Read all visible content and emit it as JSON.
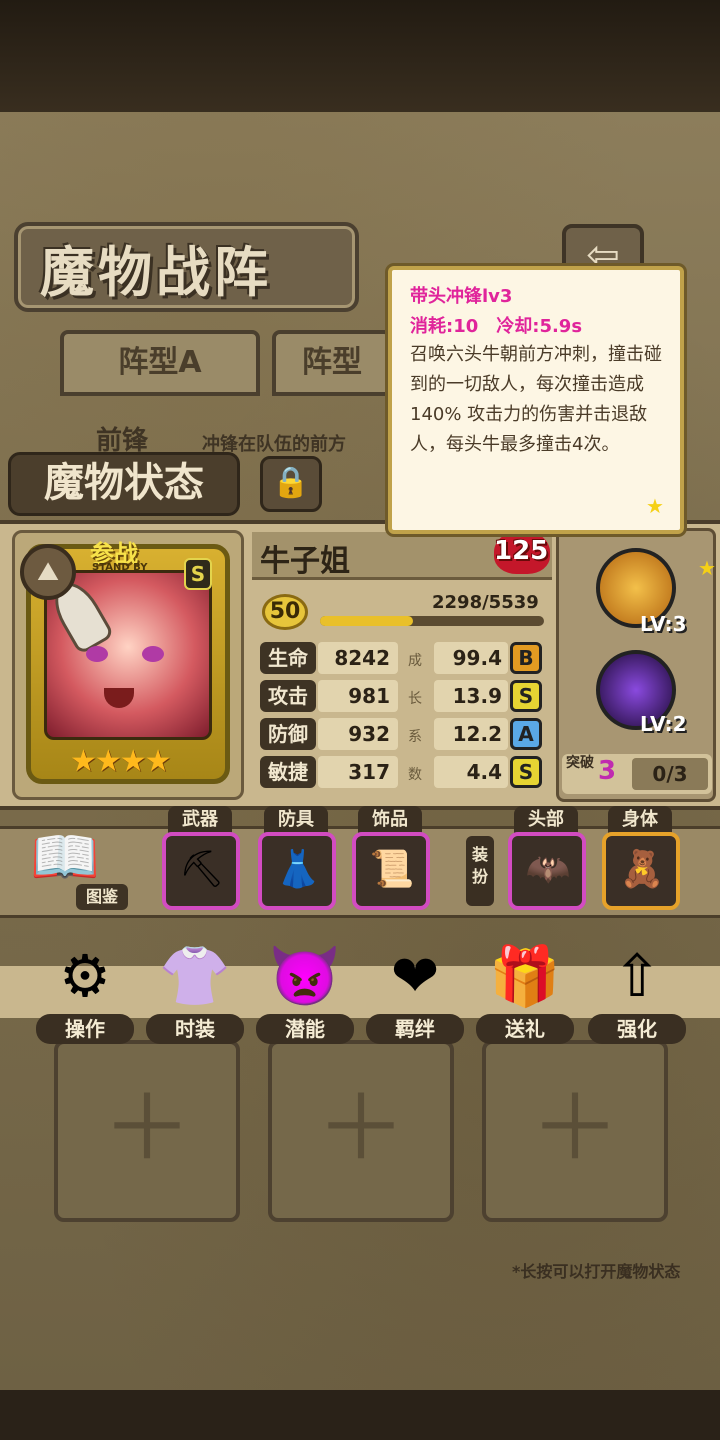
{
  "header": {
    "title": "魔物战阵",
    "back_icon": "⇦"
  },
  "tabs": [
    {
      "label": "阵型A"
    },
    {
      "label": "阵型"
    }
  ],
  "frontline": {
    "label": "前锋",
    "desc": "冲锋在队伍的前方"
  },
  "status": {
    "label": "魔物状态",
    "lock_icon": "🔒"
  },
  "monster": {
    "name": "牛子姐",
    "power": "125",
    "standby": "参战",
    "standby_sub": "STAND BY",
    "rank": "S",
    "stars": "★★★★",
    "level": "50",
    "exp": "2298/5539",
    "exp_fraction": 0.415,
    "stats": [
      {
        "label": "生命",
        "value": "8242",
        "growth": "99.4",
        "grade": "B",
        "grade_color": "#e39b22"
      },
      {
        "label": "攻击",
        "value": "981",
        "growth": "13.9",
        "grade": "S",
        "grade_color": "#e6d433"
      },
      {
        "label": "防御",
        "value": "932",
        "growth": "12.2",
        "grade": "A",
        "grade_color": "#5aa8e6"
      },
      {
        "label": "敏捷",
        "value": "317",
        "growth": "4.4",
        "grade": "S",
        "grade_color": "#e6d433"
      }
    ],
    "growth_label": [
      "成",
      "长",
      "系",
      "数"
    ]
  },
  "skills": [
    {
      "level": "LV:3",
      "color": "#d88a1e"
    },
    {
      "level": "LV:2",
      "color": "#5a2a8a"
    }
  ],
  "breakthrough": {
    "label": "突破",
    "count": "3",
    "progress": "0/3"
  },
  "equipment": {
    "book_label": "图鉴",
    "slots": [
      {
        "label": "武器",
        "icon": "⛏"
      },
      {
        "label": "防具",
        "icon": "👗"
      },
      {
        "label": "饰品",
        "icon": "📜"
      }
    ],
    "dress_label": "装扮",
    "dress_slots": [
      {
        "label": "头部",
        "icon": "🦇"
      },
      {
        "label": "身体",
        "icon": "🧸"
      }
    ]
  },
  "actions": [
    {
      "label": "操作",
      "icon": "⚙"
    },
    {
      "label": "时装",
      "icon": "👚"
    },
    {
      "label": "潜能",
      "icon": "👿"
    },
    {
      "label": "羁绊",
      "icon": "❤"
    },
    {
      "label": "送礼",
      "icon": "🎁"
    },
    {
      "label": "强化",
      "icon": "⇧"
    }
  ],
  "hint": "*长按可以打开魔物状态",
  "tooltip": {
    "name": "带头冲锋lv3",
    "cost": "消耗:10　冷却:5.9s",
    "desc": "召唤六头牛朝前方冲刺，撞击碰到的一切敌人，每次撞击造成140% 攻击力的伤害并击退敌人，每头牛最多撞击4次。"
  }
}
